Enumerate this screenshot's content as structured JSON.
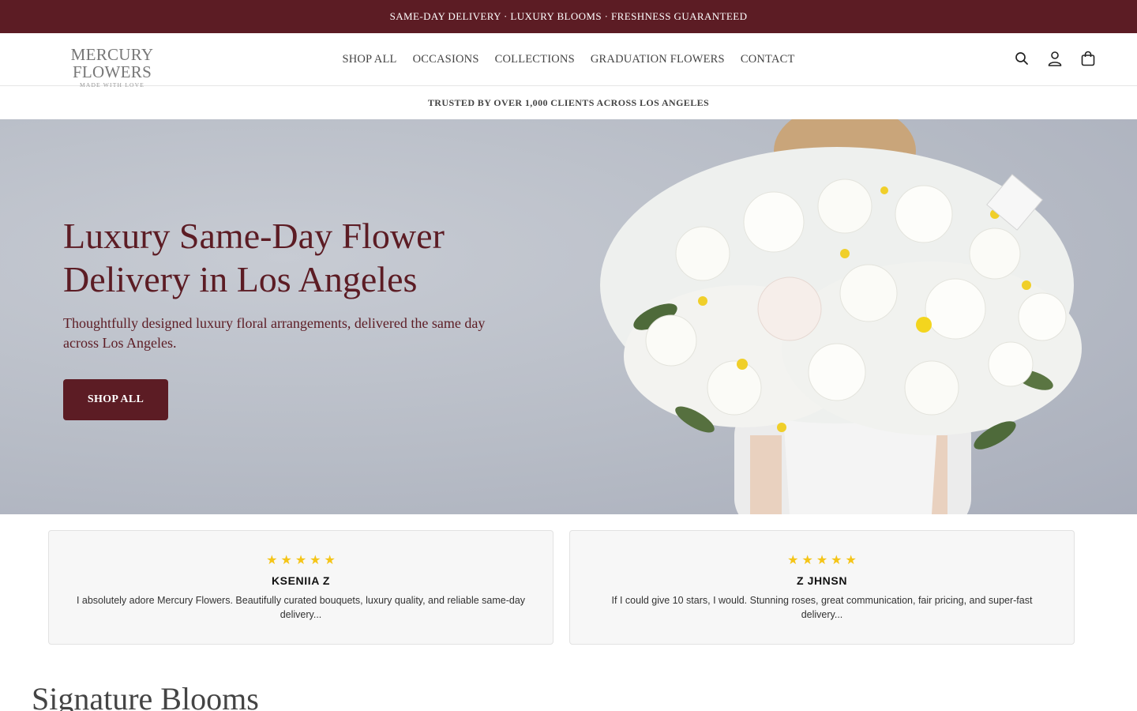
{
  "announcement": "SAME-DAY DELIVERY · LUXURY BLOOMS · FRESHNESS GUARANTEED",
  "logo": {
    "name": "MERCURY FLOWERS",
    "tagline": "MADE WITH LOVE"
  },
  "nav": [
    "SHOP ALL",
    "OCCASIONS",
    "COLLECTIONS",
    "GRADUATION FLOWERS",
    "CONTACT"
  ],
  "icons": {
    "search": "search-icon",
    "account": "account-icon",
    "cart": "cart-icon"
  },
  "trust_bar": "TRUSTED BY OVER 1,000 CLIENTS ACROSS LOS ANGELES",
  "hero": {
    "title": "Luxury Same-Day Flower Delivery in Los Angeles",
    "subtitle": "Thoughtfully designed luxury floral arrangements, delivered the same day across Los Angeles.",
    "cta": "SHOP ALL"
  },
  "reviews": [
    {
      "rating": 5,
      "name": "KSENIIA Z",
      "text": "I absolutely adore Mercury Flowers. Beautifully curated bouquets, luxury quality, and reliable same-day delivery..."
    },
    {
      "rating": 5,
      "name": "Z JHNSN",
      "text": "If I could give 10 stars, I would. Stunning roses, great communication, fair pricing, and super-fast delivery..."
    }
  ],
  "section": {
    "title": "Signature Blooms"
  },
  "colors": {
    "brand": "#5c1c24",
    "star": "#f5c518",
    "hero_bg": "#b7bcc6"
  }
}
